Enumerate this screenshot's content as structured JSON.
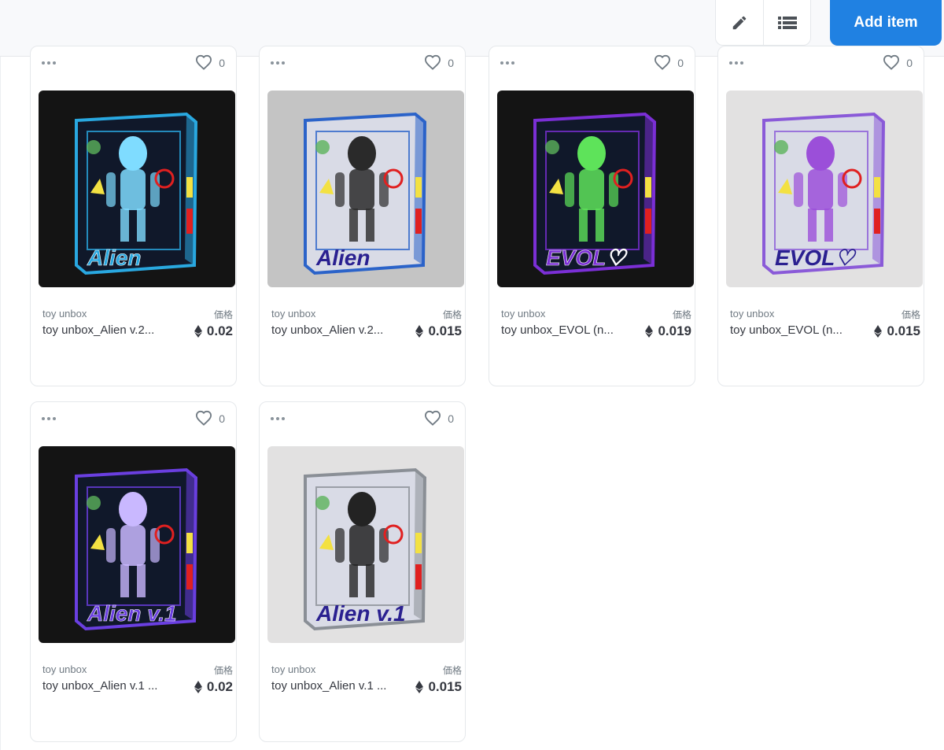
{
  "toolbar": {
    "edit_icon": "pencil-icon",
    "list_icon": "list-view-icon",
    "add_label": "Add item"
  },
  "accent_color": "#2081e2",
  "cards": [
    {
      "collection": "toy unbox",
      "title": "toy unbox_Alien v.2...",
      "price_label": "価格",
      "price": "0.02",
      "likes": "0",
      "image": "alien-v2-box-dark",
      "theme": "dark",
      "box": "#29a8e0",
      "figure": "#7fdcff",
      "txt": "Alien"
    },
    {
      "collection": "toy unbox",
      "title": "toy unbox_Alien v.2...",
      "price_label": "価格",
      "price": "0.015",
      "likes": "0",
      "image": "alien-v2-box-grey",
      "theme": "grey",
      "box": "#2b63c9",
      "figure": "#2a2a2a",
      "txt": "Alien"
    },
    {
      "collection": "toy unbox",
      "title": "toy unbox_EVOL (n...",
      "price_label": "価格",
      "price": "0.019",
      "likes": "0",
      "image": "evol-box-dark",
      "theme": "dark",
      "box": "#7b2fd6",
      "figure": "#5ee35a",
      "txt": "EVOL♡"
    },
    {
      "collection": "toy unbox",
      "title": "toy unbox_EVOL (n...",
      "price_label": "価格",
      "price": "0.015",
      "likes": "0",
      "image": "evol-box-light",
      "theme": "lightgrey",
      "box": "#8a5ad8",
      "figure": "#9b4fd9",
      "txt": "EVOL♡"
    },
    {
      "collection": "toy unbox",
      "title": "toy unbox_Alien v.1 ...",
      "price_label": "価格",
      "price": "0.02",
      "likes": "0",
      "image": "alien-v1-box-dark",
      "theme": "dark",
      "box": "#6a3fe0",
      "figure": "#c9b8ff",
      "txt": "Alien v.1"
    },
    {
      "collection": "toy unbox",
      "title": "toy unbox_Alien v.1 ...",
      "price_label": "価格",
      "price": "0.015",
      "likes": "0",
      "image": "alien-v1-box-light",
      "theme": "lightgrey",
      "box": "#8a8f96",
      "figure": "#232323",
      "txt": "Alien v.1"
    }
  ]
}
